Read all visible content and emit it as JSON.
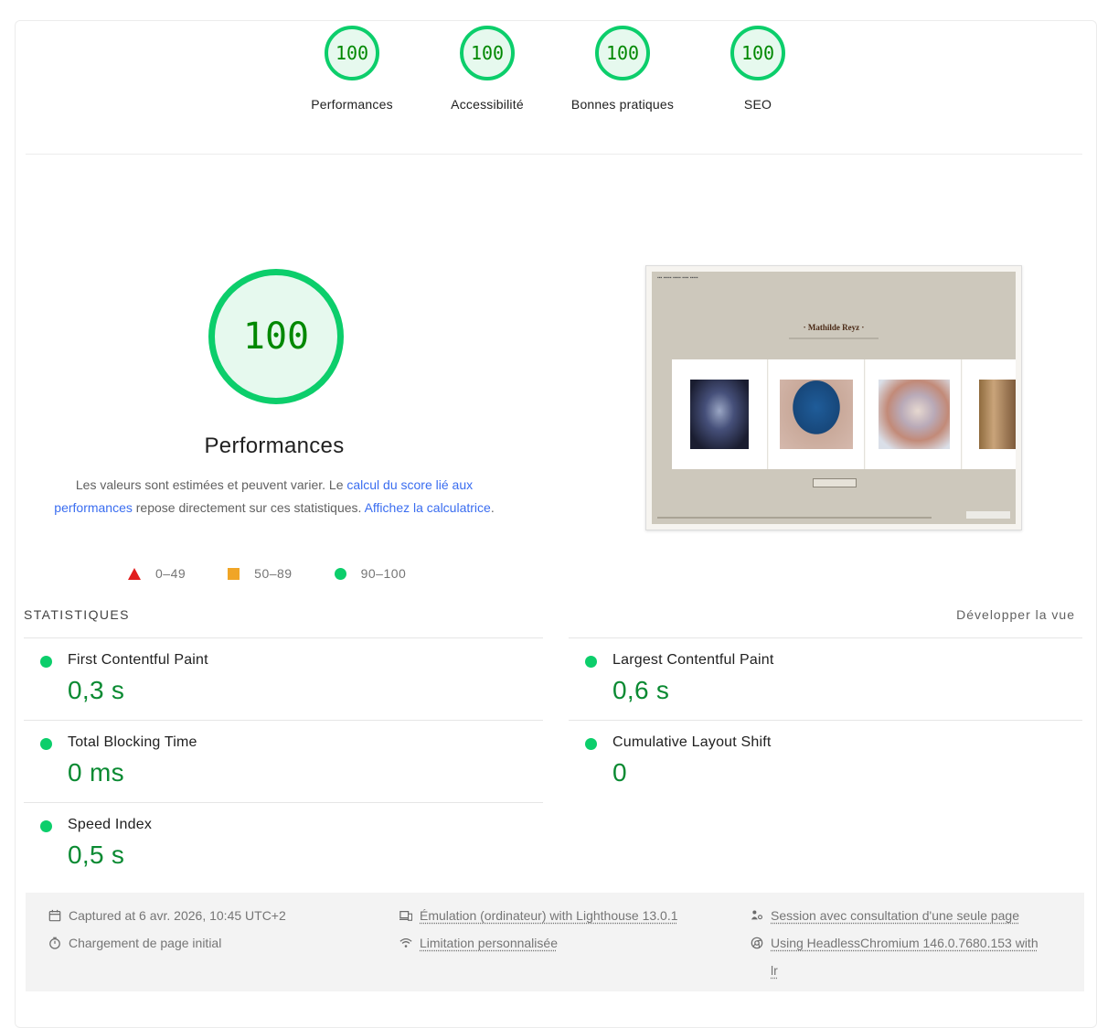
{
  "gauges": [
    {
      "score": "100",
      "label": "Performances"
    },
    {
      "score": "100",
      "label": "Accessibilité"
    },
    {
      "score": "100",
      "label": "Bonnes pratiques"
    },
    {
      "score": "100",
      "label": "SEO"
    }
  ],
  "performance": {
    "score": "100",
    "title": "Performances",
    "desc_part1": "Les valeurs sont estimées et peuvent varier. Le ",
    "desc_link1": "calcul du score lié aux performances",
    "desc_part2": " repose directement sur ces statistiques. ",
    "desc_link2": "Affichez la calculatrice",
    "desc_part3": "."
  },
  "legend": {
    "fail": "0–49",
    "average": "50–89",
    "pass": "90–100"
  },
  "thumbnail": {
    "site_name": "· Mathilde Reyz ·"
  },
  "statistics": {
    "heading": "STATISTIQUES",
    "expand_label": "Développer la vue",
    "metrics": [
      {
        "name": "First Contentful Paint",
        "value": "0,3 s"
      },
      {
        "name": "Largest Contentful Paint",
        "value": "0,6 s"
      },
      {
        "name": "Total Blocking Time",
        "value": "0 ms"
      },
      {
        "name": "Cumulative Layout Shift",
        "value": "0"
      },
      {
        "name": "Speed Index",
        "value": "0,5 s"
      }
    ]
  },
  "environment": {
    "captured": "Captured at 6 avr. 2026, 10:45 UTC+2",
    "emulation": "Émulation (ordinateur) with Lighthouse 13.0.1",
    "session": "Session avec consultation d'une seule page",
    "load": "Chargement de page initial",
    "throttling": "Limitation personnalisée",
    "browser_line1": "Using HeadlessChromium 146.0.7680.153 with",
    "browser_line2": "lr"
  },
  "colors": {
    "pass": "#0cce6b",
    "pass_text": "#008800",
    "average": "#f0a526",
    "fail": "#e11d1d",
    "link": "#3a6df0"
  },
  "icons": {
    "fail": "triangle-icon",
    "average": "square-icon",
    "pass": "circle-icon",
    "captured": "calendar-icon",
    "emulation": "devices-icon",
    "session": "person-icon",
    "load": "stopwatch-icon",
    "throttling": "wifi-icon",
    "browser": "chrome-icon"
  }
}
